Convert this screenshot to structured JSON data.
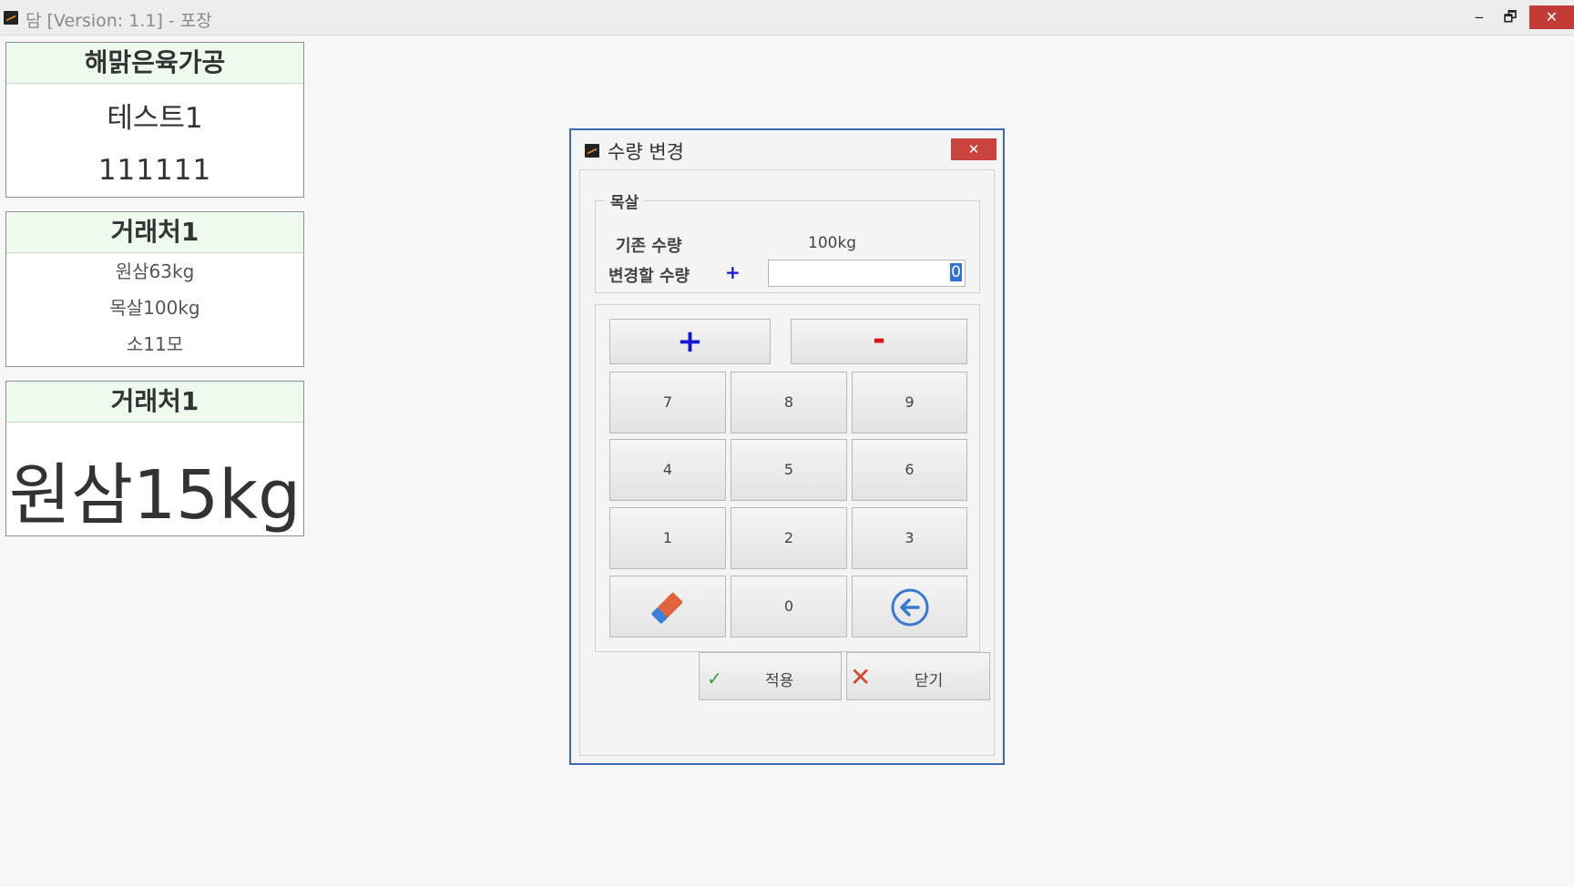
{
  "window": {
    "title": "담 [Version: 1.1] - 포장",
    "minimize": "‒",
    "restore": "🗗",
    "close": "✕"
  },
  "panels": {
    "company": {
      "header": "해맑은육가공",
      "name": "테스트1",
      "code": "111111"
    },
    "client_list": {
      "header": "거래처1",
      "items": [
        "원삼63kg",
        "목살100kg",
        "소11모"
      ]
    },
    "client_current": {
      "header": "거래처1",
      "big_text": "원삼15kg"
    }
  },
  "dialog": {
    "title": "수량 변경",
    "close": "✕",
    "group_label": "목살",
    "existing_label": "기존 수량",
    "existing_value": "100kg",
    "change_label": "변경할 수량",
    "sign_indicator": "+",
    "input_value": "0",
    "keys": {
      "plus": "+",
      "minus": "-",
      "k7": "7",
      "k8": "8",
      "k9": "9",
      "k4": "4",
      "k5": "5",
      "k6": "6",
      "k1": "1",
      "k2": "2",
      "k3": "3",
      "k0": "0"
    },
    "apply_label": "적용",
    "close_label": "닫기",
    "icons": {
      "eraser": "eraser-icon",
      "backspace": "back-arrow-icon",
      "apply": "check-icon",
      "close": "x-icon"
    }
  }
}
